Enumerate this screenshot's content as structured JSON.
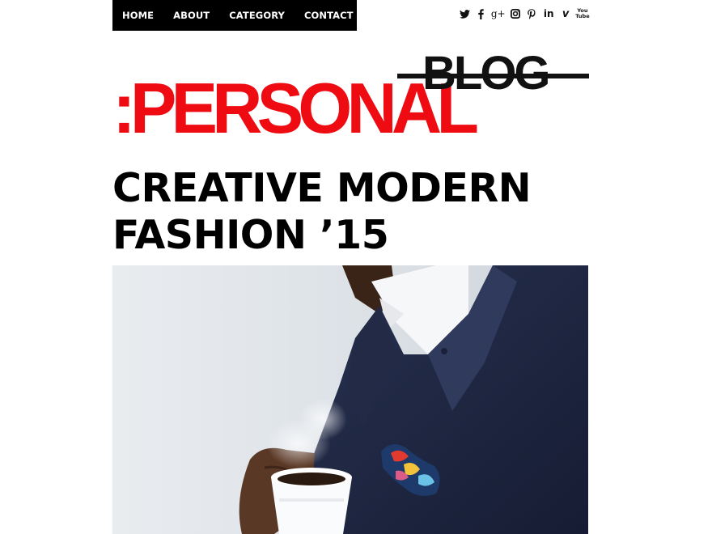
{
  "nav": {
    "items": [
      {
        "label": "HOME",
        "name": "nav-home"
      },
      {
        "label": "ABOUT",
        "name": "nav-about"
      },
      {
        "label": "CATEGORY",
        "name": "nav-category"
      },
      {
        "label": "CONTACT",
        "name": "nav-contact"
      }
    ]
  },
  "social": {
    "icons": [
      "twitter-icon",
      "facebook-icon",
      "google-plus-icon",
      "instagram-icon",
      "pinterest-icon",
      "linkedin-icon",
      "vimeo-icon",
      "youtube-icon"
    ],
    "google_plus_text": "g+",
    "linkedin_text": "in",
    "vimeo_text": "v",
    "youtube_text": "You\nTube"
  },
  "logo": {
    "prefix": ":PERSONAL",
    "struck_word": "BLOG",
    "primary_color": "#ee0b12",
    "secondary_color": "#111111"
  },
  "post": {
    "title_line1": "CREATIVE MODERN",
    "title_line2": "FASHION ’15"
  },
  "hero_image": {
    "subject": "man in navy blazer holding coffee cup with patterned pocket square"
  }
}
